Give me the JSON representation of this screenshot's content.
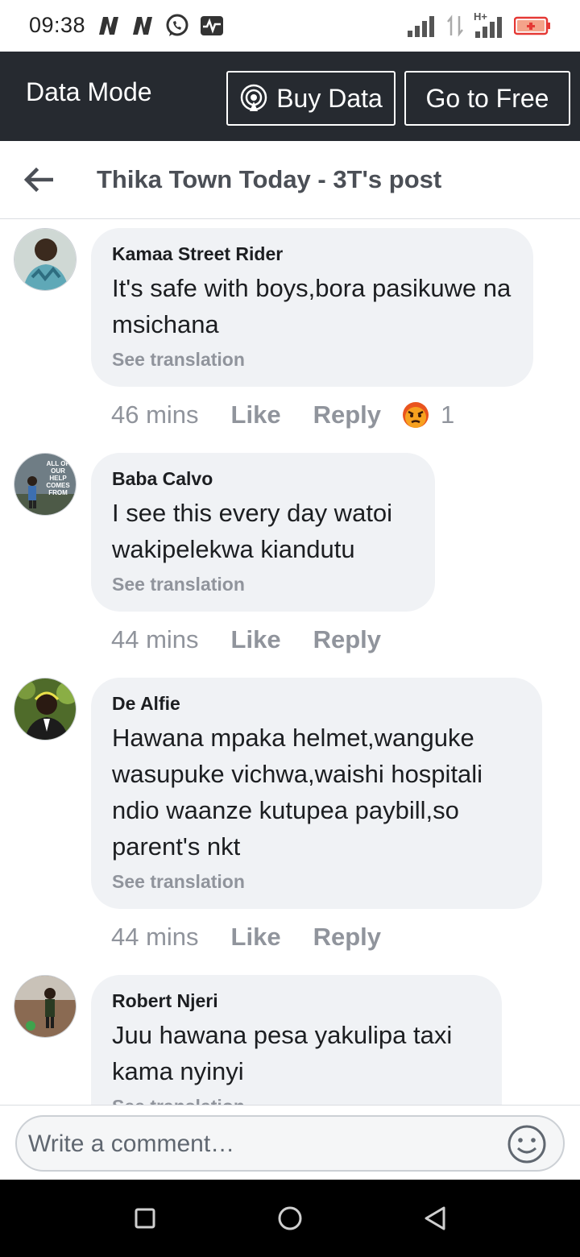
{
  "status_bar": {
    "time": "09:38",
    "left_icons": [
      "netflix-n-icon",
      "netflix-n-icon",
      "whatsapp-icon",
      "activity-icon"
    ],
    "right_icons": [
      "signal-icon",
      "data-arrows-icon",
      "hplus-signal-icon",
      "battery-icon"
    ],
    "network_label": "H+"
  },
  "data_bar": {
    "mode_label": "Data Mode",
    "buy_data_label": "Buy Data",
    "go_free_label": "Go to Free",
    "background": "#262a30"
  },
  "header": {
    "title": "Thika Town Today - 3T's post"
  },
  "comments": [
    {
      "author": "Kamaa Street Rider",
      "text": "It's safe with boys,bora pasikuwe na msichana",
      "see_translation": "See translation",
      "time": "46 mins",
      "like": "Like",
      "reply": "Reply",
      "reaction_icon": "angry-reaction-icon",
      "reaction_count": "1"
    },
    {
      "author": "Baba Calvo",
      "text": "I see this every day watoi wakipelekwa kiandutu",
      "see_translation": "See translation",
      "time": "44 mins",
      "like": "Like",
      "reply": "Reply",
      "avatar_text": "ALL OF OUR HELP COMES FROM"
    },
    {
      "author": "De Alfie",
      "text": "Hawana mpaka helmet,wanguke wasupuke vichwa,waishi hospitali ndio waanze kutupea paybill,so parent's nkt",
      "see_translation": "See translation",
      "time": "44 mins",
      "like": "Like",
      "reply": "Reply"
    },
    {
      "author": "Robert Njeri",
      "text": "Juu hawana pesa yakulipa taxi kama nyinyi",
      "see_translation": "See translation"
    }
  ],
  "composer": {
    "placeholder": "Write a comment…",
    "emoji_icon": "smiley-icon"
  },
  "nav_bar": {
    "icons": [
      "recents-square-icon",
      "home-circle-icon",
      "back-triangle-icon"
    ]
  }
}
